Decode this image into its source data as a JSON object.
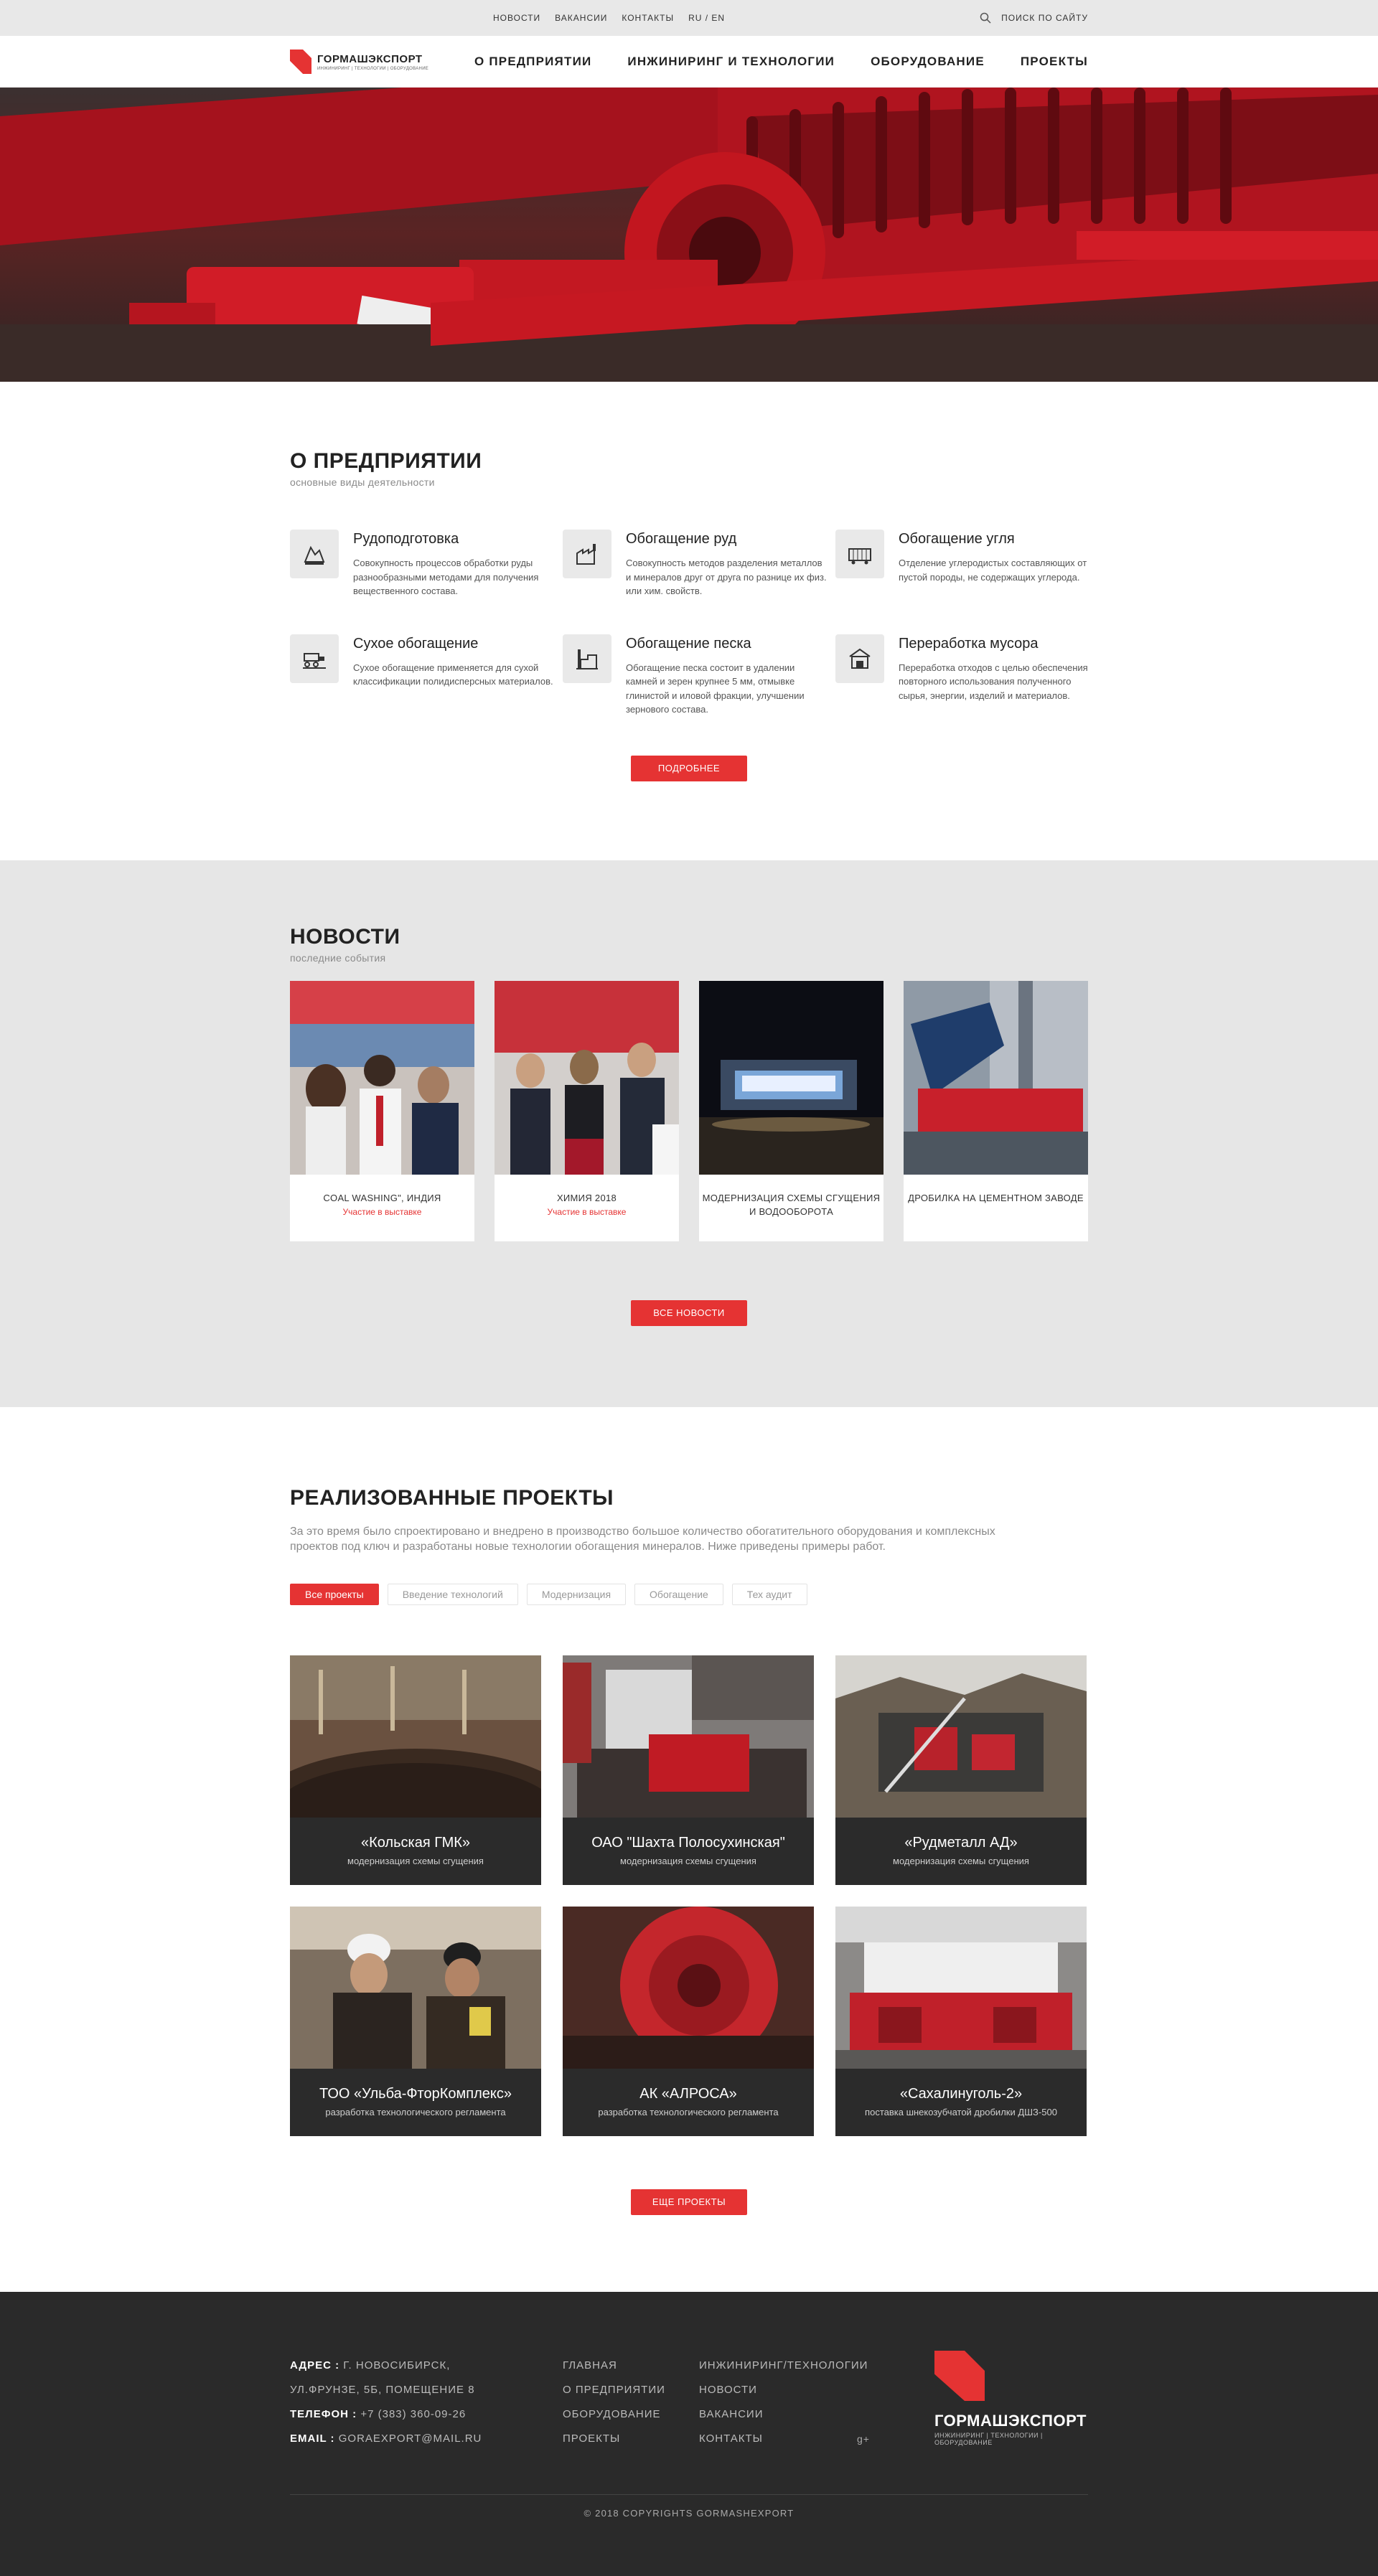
{
  "topbar": {
    "links": [
      "НОВОСТИ",
      "ВАКАНСИИ",
      "КОНТАКТЫ",
      "RU / EN"
    ],
    "search_label": "ПОИСК ПО САЙТУ"
  },
  "header": {
    "logo_name": "ГОРМАШЭКСПОРТ",
    "logo_sub": "ИНЖИНИРИНГ | ТЕХНОЛОГИИ | ОБОРУДОВАНИЕ",
    "nav": [
      "О ПРЕДПРИЯТИИ",
      "ИНЖИНИРИНГ И ТЕХНОЛОГИИ",
      "ОБОРУДОВАНИЕ",
      "ПРОЕКТЫ"
    ]
  },
  "about": {
    "title": "О ПРЕДПРИЯТИИ",
    "subtitle": "основные виды деятельности",
    "items": [
      {
        "title": "Рудоподготовка",
        "desc": "Совокупность процессов обработки руды разнообразными методами для получения вещественного состава.",
        "icon": "crusher-icon"
      },
      {
        "title": "Обогащение руд",
        "desc": "Совокупность методов разделения металлов и минералов друг от друга по разнице их физ. или хим. свойств.",
        "icon": "factory-icon"
      },
      {
        "title": "Обогащение угля",
        "desc": "Отделение углеродистых составляющих от пустой породы, не содержащих углерода.",
        "icon": "coal-wagon-icon"
      },
      {
        "title": "Сухое обогащение",
        "desc": "Сухое обогащение применяется для сухой классификации полидисперсных материалов.",
        "icon": "conveyor-icon"
      },
      {
        "title": "Обогащение песка",
        "desc": "Обогащение песка состоит в удалении камней и зерен крупнее 5 мм, отмывке глинистой и иловой фракции, улучшении зернового состава.",
        "icon": "plant-icon"
      },
      {
        "title": "Переработка мусора",
        "desc": "Переработка отходов с целью обеспечения повторного использования полученного сырья, энергии, изделий и материалов.",
        "icon": "recycling-plant-icon"
      }
    ],
    "button": "ПОДРОБНЕЕ"
  },
  "news": {
    "title": "НОВОСТИ",
    "subtitle": "последние события",
    "items": [
      {
        "title": "COAL WASHING\", ИНДИЯ",
        "sub": "Участие в выставке"
      },
      {
        "title": "ХИМИЯ 2018",
        "sub": "Участие в выставке"
      },
      {
        "title": "МОДЕРНИЗАЦИЯ СХЕМЫ СГУЩЕНИЯ И ВОДООБОРОТА",
        "sub": ""
      },
      {
        "title": "ДРОБИЛКА НА ЦЕМЕНТНОМ ЗАВОДЕ",
        "sub": ""
      }
    ],
    "button": "ВСЕ НОВОСТИ"
  },
  "projects": {
    "title": "РЕАЛИЗОВАННЫЕ ПРОЕКТЫ",
    "desc": "За это время было спроектировано и внедрено в производство большое количество обогатительного оборудования и комплексных проектов под ключ и разработаны новые технологии обогащения минералов. Ниже приведены примеры работ.",
    "filters": [
      "Все проекты",
      "Введение технологий",
      "Модернизация",
      "Обогащение",
      "Тех аудит"
    ],
    "items": [
      {
        "title": "«Кольская ГМК»",
        "sub": "модернизация схемы сгущения"
      },
      {
        "title": "ОАО \"Шахта Полосухинская\"",
        "sub": "модернизация схемы сгущения"
      },
      {
        "title": "«Рудметалл АД»",
        "sub": "модернизация схемы сгущения"
      },
      {
        "title": "ТОО «Ульба-ФторКомплекс»",
        "sub": "разработка технологического регламента"
      },
      {
        "title": "АК «АЛРОСА»",
        "sub": "разработка технологического регламента"
      },
      {
        "title": "«Сахалинуголь-2»",
        "sub": "поставка шнекозубчатой дробилки ДШЗ-500"
      }
    ],
    "button": "ЕЩЕ ПРОЕКТЫ"
  },
  "footer": {
    "address_label": "АДРЕС :",
    "address_1": " Г. НОВОСИБИРСК,",
    "address_2": "УЛ.ФРУНЗЕ, 5Б, ПОМЕЩЕНИЕ 8",
    "phone_label": "ТЕЛЕФОН :",
    "phone": " +7 (383) 360-09-26",
    "email_label": "EMAIL :",
    "email": " GORAEXPORT@MAIL.RU",
    "col2": [
      "ГЛАВНАЯ",
      "О ПРЕДПРИЯТИИ",
      "ОБОРУДОВАНИЕ",
      "ПРОЕКТЫ"
    ],
    "col3": [
      "ИНЖИНИРИНГ/ТЕХНОЛОГИИ",
      "НОВОСТИ",
      "ВАКАНСИИ",
      "КОНТАКТЫ"
    ],
    "social": "g+",
    "logo_name": "ГОРМАШЭКСПОРТ",
    "logo_sub": "ИНЖИНИРИНГ | ТЕХНОЛОГИИ | ОБОРУДОВАНИЕ",
    "copyright": "© 2018 COPYRIGHTS GORMASHEXPORT"
  },
  "colors": {
    "accent": "#e53333",
    "dark": "#2a2a2a",
    "light_bg": "#e6e6e6"
  }
}
